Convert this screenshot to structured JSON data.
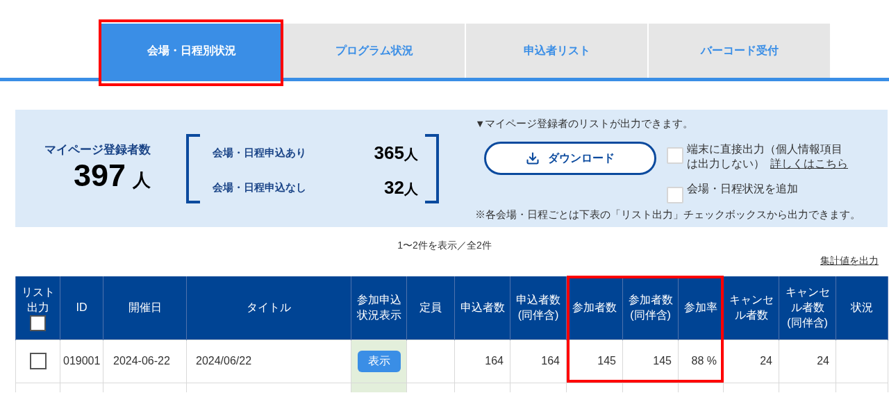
{
  "tabs": [
    {
      "label": "会場・日程別状況",
      "selected": true,
      "highlighted": true
    },
    {
      "label": "プログラム状況",
      "selected": false,
      "highlighted": false
    },
    {
      "label": "申込者リスト",
      "selected": false,
      "highlighted": false
    },
    {
      "label": "バーコード受付",
      "selected": false,
      "highlighted": false
    }
  ],
  "summary": {
    "title": "マイページ登録者数",
    "total": {
      "value": "397",
      "unit": "人"
    },
    "breakdown": [
      {
        "label": "会場・日程申込あり",
        "value": "365",
        "unit": "人"
      },
      {
        "label": "会場・日程申込なし",
        "value": "32",
        "unit": "人"
      }
    ]
  },
  "export": {
    "intro": "▼マイページ登録者のリストが出力できます。",
    "download_button": "ダウンロード",
    "options": [
      {
        "label": "端末に直接出力（個人情報項目は出力しない）",
        "link": "詳しくはこちら",
        "checked": false
      },
      {
        "label": "会場・日程状況を追加",
        "checked": false
      }
    ],
    "note": "※各会場・日程ごとは下表の「リスト出力」チェックボックスから出力できます。"
  },
  "pagination": "1〜2件を表示／全2件",
  "totals_link": "集計値を出力",
  "table": {
    "columns": [
      {
        "label": "リスト出力",
        "kind": "check",
        "checked": false,
        "highlighted": false
      },
      {
        "label": "ID",
        "kind": "id",
        "highlighted": false
      },
      {
        "label": "開催日",
        "kind": "date",
        "highlighted": false
      },
      {
        "label": "タイトル",
        "kind": "title",
        "highlighted": false
      },
      {
        "label": "参加申込状況表示",
        "kind": "action",
        "highlighted": false
      },
      {
        "label": "定員",
        "kind": "capacity",
        "highlighted": false
      },
      {
        "label": "申込者数",
        "kind": "count",
        "highlighted": false
      },
      {
        "label": "申込者数(同伴含)",
        "kind": "count",
        "highlighted": false
      },
      {
        "label": "参加者数",
        "kind": "count",
        "highlighted": true
      },
      {
        "label": "参加者数(同伴含)",
        "kind": "count",
        "highlighted": true
      },
      {
        "label": "参加率",
        "kind": "count",
        "highlighted": true
      },
      {
        "label": "キャンセル者数",
        "kind": "count",
        "highlighted": false
      },
      {
        "label": "キャンセル者数(同伴含)",
        "kind": "count",
        "highlighted": false
      },
      {
        "label": "状況",
        "kind": "status",
        "highlighted": false
      }
    ],
    "rows": [
      {
        "checked": false,
        "id": "019001",
        "date": "2024-06-22",
        "title": "2024/06/22",
        "action": "表示",
        "counts": [
          "164",
          "164",
          "145",
          "145",
          "88 %",
          "24",
          "24"
        ]
      }
    ]
  }
}
